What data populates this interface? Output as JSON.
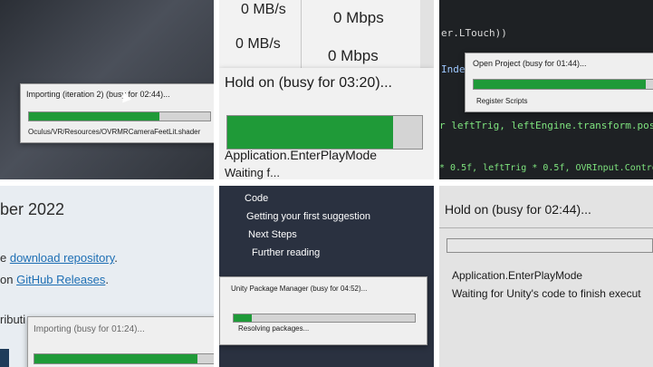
{
  "tile1": {
    "title": "Importing (iteration 2) (busy for 02:44)...",
    "progress": 0.72,
    "subtitle": "Oculus/VR/Resources/OVRMRCameraFeetLit.shader"
  },
  "tile2": {
    "stat1_left": "0 MB/s",
    "stat1_right": "0 Mbps",
    "stat2_left": "0 MB/s",
    "stat2_right": "0 Mbps",
    "title": "Hold on (busy for 03:20)...",
    "progress": 0.85,
    "subtitle": "Application.EnterPlayMode",
    "subtitle2": "Waiting f..."
  },
  "tile3": {
    "code_top": "er.LTouch))",
    "code_index": "Index",
    "title": "Open Project (busy for 01:44)...",
    "progress": 0.95,
    "subtitle": "Register Scripts",
    "code_line1": "r leftTrig, leftEngine.transform.positi",
    "code_line2": "* 0.5f, leftTrig * 0.5f, OVRInput.Control"
  },
  "tile4": {
    "heading": "ber 2022",
    "line1_pre": "e ",
    "line1_link": "download repository",
    "line1_post": ".",
    "line2_pre": "on ",
    "line2_link": "GitHub Releases",
    "line2_post": ".",
    "line3": "ributi",
    "title": "Importing (busy for 01:24)...",
    "progress": 0.9
  },
  "tile5": {
    "menu": [
      "Code",
      "Getting your first suggestion",
      "Next Steps",
      "Further reading"
    ],
    "title": "Unity Package Manager (busy for 04:52)...",
    "progress": 0.1,
    "subtitle": "Resolving packages..."
  },
  "tile6": {
    "title": "Hold on (busy for 02:44)...",
    "progress": 0.0,
    "subtitle": "Application.EnterPlayMode",
    "subtitle2": "Waiting for Unity's code to finish execut"
  }
}
